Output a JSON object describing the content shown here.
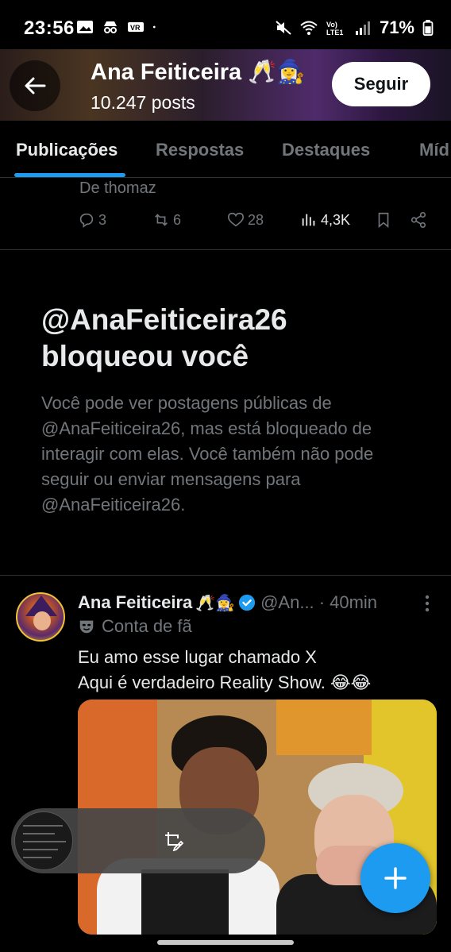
{
  "status_bar": {
    "time": "23:56",
    "battery": "71%",
    "icons": [
      "image-icon",
      "incognito-icon",
      "key-icon",
      "dot-icon",
      "mute-icon",
      "wifi-icon",
      "volte-icon",
      "signal-icon",
      "battery-icon"
    ]
  },
  "header": {
    "name": "Ana Feiticeira 🥂🧙‍♀️",
    "posts": "10.247 posts",
    "follow_label": "Seguir"
  },
  "tabs": [
    {
      "label": "Publicações",
      "active": true
    },
    {
      "label": "Respostas",
      "active": false
    },
    {
      "label": "Destaques",
      "active": false
    },
    {
      "label": "Míd",
      "active": false
    }
  ],
  "previous_tweet": {
    "tail_text": "De thomaz",
    "replies": "3",
    "retweets": "6",
    "likes": "28",
    "views": "4,3K"
  },
  "blocked_notice": {
    "title": "@AnaFeiticeira26 bloqueou você",
    "description": "Você pode ver postagens públicas de @AnaFeiticeira26, mas está bloqueado de interagir com elas. Você também não pode seguir ou enviar mensagens para @AnaFeiticeira26."
  },
  "tweet": {
    "name": "Ana Feiticeira",
    "name_emoji": "🥂🧙‍♀️",
    "handle": "@An...",
    "time": "· 40min",
    "label": "Conta de fã",
    "text_line1": "Eu amo esse lugar chamado X",
    "text_line2": "Aqui é verdadeiro Reality Show. 😂😂"
  },
  "colors": {
    "accent": "#1d9bf0",
    "muted": "#71767b",
    "text": "#e7e9ea",
    "divider": "#2f3336"
  }
}
